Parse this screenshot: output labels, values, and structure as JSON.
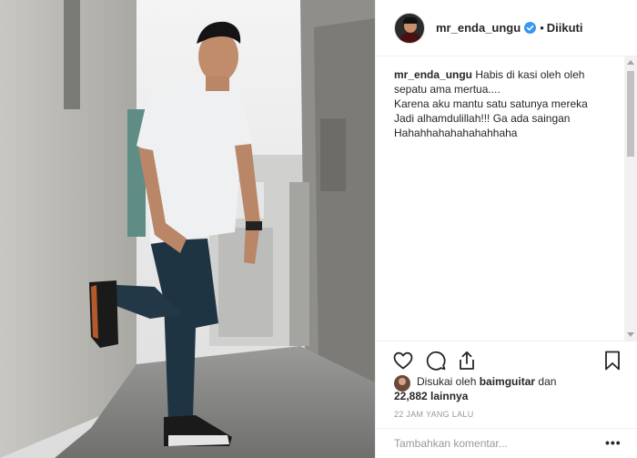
{
  "post": {
    "username": "mr_enda_ungu",
    "follow_status": "Diikuti",
    "separator": "•",
    "caption_lines": [
      "Habis di kasi oleh oleh",
      "sepatu ama mertua....",
      "Karena aku mantu satu satunya mereka",
      "Jadi alhamdulillah!!! Ga ada saingan",
      "Hahahhahahahahahhaha"
    ]
  },
  "likes": {
    "prefix": "Disukai oleh",
    "liker": "baimguitar",
    "conjunction": "dan",
    "count": "22,882",
    "suffix": "lainnya"
  },
  "timestamp": "22 JAM YANG LALU",
  "comment_input": {
    "placeholder": "Tambahkan komentar..."
  },
  "more_label": "•••",
  "icons": {
    "verified": "verified-badge-icon",
    "like": "heart-icon",
    "comment": "comment-bubble-icon",
    "share": "share-icon",
    "save": "bookmark-icon"
  },
  "colors": {
    "verified_blue": "#3897f0",
    "text": "#262626",
    "muted": "#999999",
    "divider": "#efefef"
  }
}
